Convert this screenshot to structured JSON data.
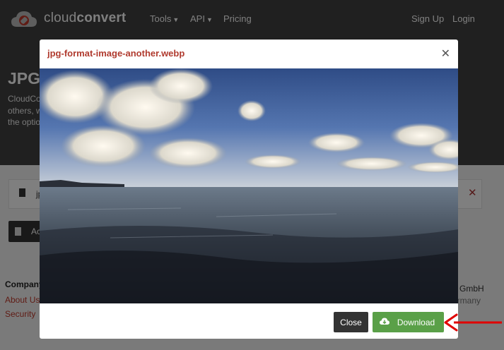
{
  "nav": {
    "brand_light": "cloud",
    "brand_bold": "convert",
    "tools": "Tools",
    "api": "API",
    "pricing": "Pricing",
    "signup": "Sign Up",
    "login": "Login"
  },
  "hero": {
    "title": "JPG",
    "line1": "CloudCo",
    "line2": "others, w",
    "line3": "the optio"
  },
  "file_row": {
    "name": "jp"
  },
  "add_button": {
    "label": "Ac"
  },
  "footer": {
    "heading": "Company",
    "about": "About Us",
    "security": "Security",
    "company_name": "o GmbH",
    "country": "ermany"
  },
  "modal": {
    "title": "jpg-format-image-another.webp",
    "close_label": "Close",
    "download_label": "Download"
  },
  "colors": {
    "accent": "#b03a2e",
    "download": "#5aa048",
    "header_bg": "#404040"
  }
}
